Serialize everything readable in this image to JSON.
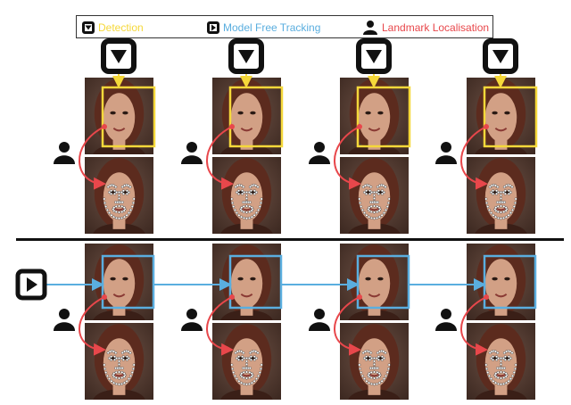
{
  "legend": {
    "detection_label": "Detection",
    "tracking_label": "Model Free Tracking",
    "landmark_label": "Landmark Localisation"
  },
  "colors": {
    "detection": "#f5d83a",
    "tracking": "#5aaedf",
    "landmark": "#e8474b",
    "icon": "#111111",
    "background_photo": "#5a4036",
    "skin": "#d2a085",
    "hair": "#5c2b1e",
    "landmark_dot": "#ffffff"
  },
  "icons": {
    "detection": "down-triangle-box-icon",
    "tracking": "play-box-icon",
    "landmark": "person-icon"
  },
  "rows": {
    "detection_frames": 4,
    "tracking_frames": 4
  }
}
